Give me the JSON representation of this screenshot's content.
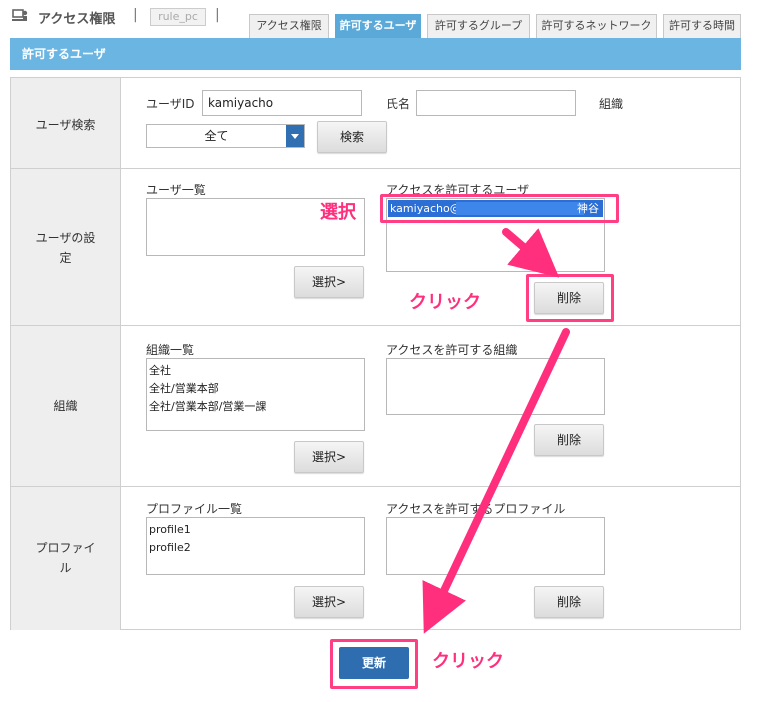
{
  "header": {
    "title": "アクセス権限",
    "separator": "|",
    "rule_chip": "rule_pc"
  },
  "tabs": [
    {
      "label": "アクセス権限",
      "active": false
    },
    {
      "label": "許可するユーザ",
      "active": true
    },
    {
      "label": "許可するグループ",
      "active": false
    },
    {
      "label": "許可するネットワーク",
      "active": false
    },
    {
      "label": "許可する時間",
      "active": false
    }
  ],
  "section_title": "許可するユーザ",
  "search": {
    "label": "ユーザ検索",
    "user_id_label": "ユーザID",
    "user_id_value": "kamiyacho",
    "name_label": "氏名",
    "name_value": "",
    "org_label": "組織",
    "org_select": "全て",
    "search_button": "検索"
  },
  "user_settings": {
    "label_line1": "ユーザの設",
    "label_line2": "定",
    "list_label": "ユーザ一覧",
    "list_items": [],
    "select_button": "選択>",
    "allowed_label": "アクセスを許可するユーザ",
    "allowed_item_id": "kamiyacho@",
    "allowed_item_tail": "神谷",
    "delete_button": "削除"
  },
  "organization": {
    "label": "組織",
    "list_label": "組織一覧",
    "list_items": [
      "全社",
      "全社/営業本部",
      "全社/営業本部/営業一課"
    ],
    "select_button": "選択>",
    "allowed_label": "アクセスを許可する組織",
    "delete_button": "削除"
  },
  "profile": {
    "label_line1": "プロファイ",
    "label_line2": "ル",
    "list_label": "プロファイル一覧",
    "list_items": [
      "profile1",
      "profile2"
    ],
    "select_button": "選択>",
    "allowed_label": "アクセスを許可するプロファイル",
    "delete_button": "削除"
  },
  "update_button": "更新",
  "annotations": {
    "select": "選択",
    "click1": "クリック",
    "click2": "クリック"
  },
  "colors": {
    "accent_blue": "#6ab5e2",
    "button_blue": "#2e6db0",
    "highlight_pink": "#ff3e83"
  }
}
